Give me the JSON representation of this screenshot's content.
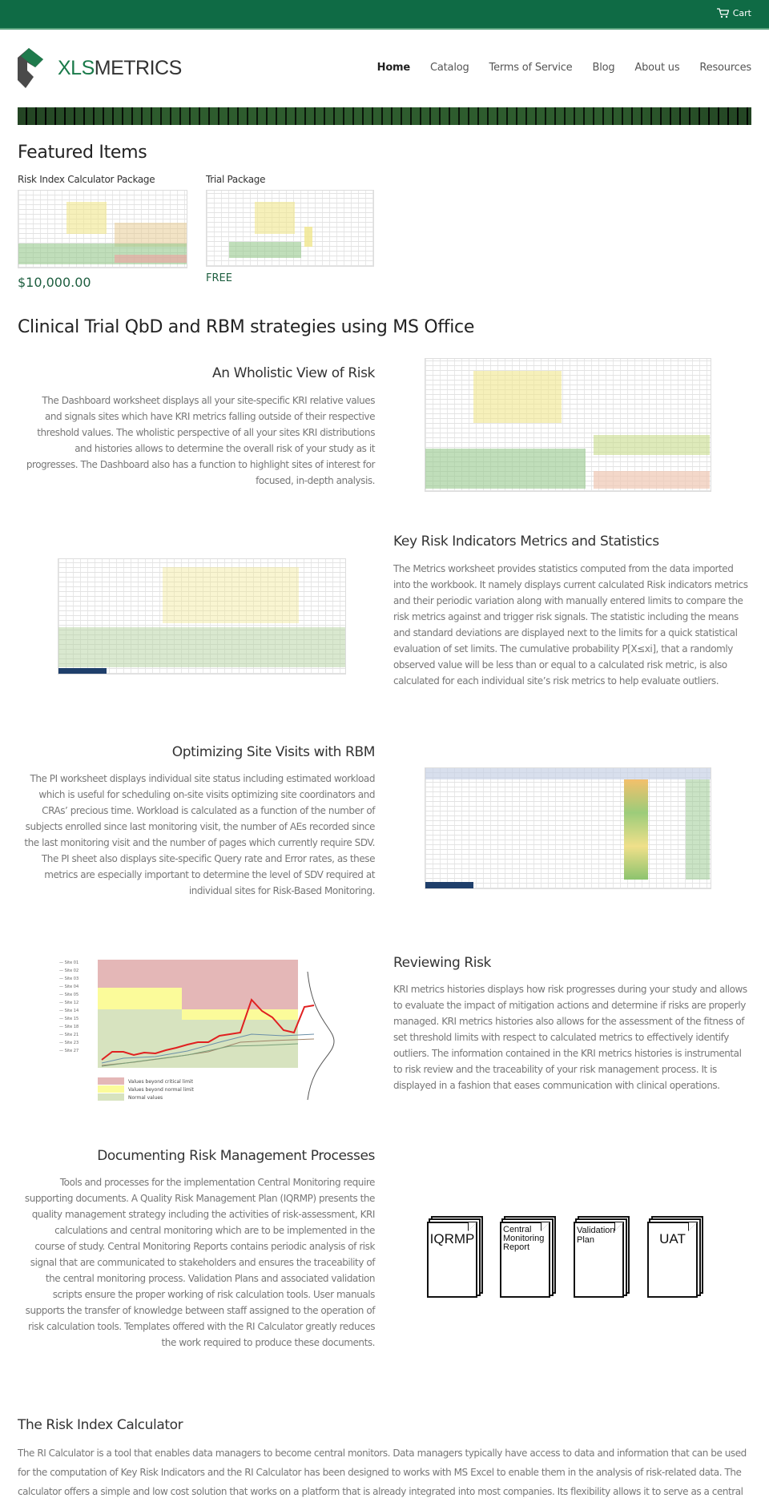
{
  "topbar": {
    "cart_label": "Cart",
    "cart_icon": "shopping-cart-icon",
    "color": "#0f6b45"
  },
  "logo": {
    "text_xls": "XLS",
    "text_metrics": "METRICS"
  },
  "nav": {
    "items": [
      {
        "label": "Home",
        "active": true
      },
      {
        "label": "Catalog"
      },
      {
        "label": "Terms of Service"
      },
      {
        "label": "Blog"
      },
      {
        "label": "About us"
      },
      {
        "label": "Resources"
      }
    ]
  },
  "featured": {
    "title": "Featured Items",
    "products": [
      {
        "name": "Risk Index Calculator Package",
        "price": "$10,000.00"
      },
      {
        "name": "Trial Package",
        "price": "FREE"
      }
    ],
    "price_color": "#1d5e3f"
  },
  "main_title": "Clinical Trial QbD and RBM strategies using MS Office",
  "sections": [
    {
      "title": "An Wholistic View of Risk",
      "text": "The Dashboard worksheet displays all your site-specific KRI relative values and signals sites which have KRI metrics falling outside of their respective threshold values. The wholistic perspective of all your sites KRI distributions and histories allows to determine the overall risk of your study as it progresses. The Dashboard also has a function to highlight sites of interest for focused, in-depth analysis."
    },
    {
      "title": "Key Risk Indicators Metrics and Statistics",
      "text": "The Metrics worksheet provides statistics computed from the data imported into the workbook. It namely displays current calculated Risk indicators metrics and their periodic variation along with manually entered limits to compare the risk metrics against and trigger risk signals. The statistic including the means and standard deviations are displayed next to the limits for a quick statistical evaluation of set limits. The cumulative probability P[X≤xi], that a randomly observed value will be less than or equal to a calculated risk metric, is also calculated for each individual site’s risk metrics to help evaluate outliers."
    },
    {
      "title": "Optimizing Site Visits with RBM",
      "text": "The PI worksheet displays individual site status including estimated workload which is useful for scheduling on-site visits optimizing site coordinators and CRAs’ precious time. Workload is calculated as a function of the number of subjects enrolled since last monitoring visit, the number of AEs recorded since the last monitoring visit and the number of pages which currently require SDV. The PI sheet also displays site-specific Query rate and Error rates, as these metrics are especially important to determine the level of SDV required at individual sites for Risk-Based Monitoring."
    },
    {
      "title": "Reviewing Risk",
      "text": "KRI metrics histories displays how risk progresses during your study and allows to evaluate the impact of mitigation actions and determine if risks are properly managed. KRI metrics histories also allows for the assessment of the fitness of set threshold limits with respect to calculated metrics to effectively identify outliers. The information contained in the KRI metrics histories is instrumental to risk review and the traceability of your risk management process. It is displayed in a fashion that eases communication with clinical operations.",
      "chart_legend": [
        "Values beyond critical limit",
        "Values beyond normal limit",
        "Normal values"
      ]
    },
    {
      "title": "Documenting Risk Management Processes",
      "text": "Tools and processes for the implementation Central Monitoring require supporting documents. A Quality Risk Management Plan (IQRMP) presents the quality management strategy including the activities of risk-assessment, KRI calculations and central monitoring which are to be implemented in the course of study. Central Monitoring Reports contains periodic analysis of risk signal that are communicated to stakeholders and ensures the traceability of the central monitoring process. Validation Plans and associated validation scripts ensure the proper working of risk calculation tools. User manuals supports the transfer of knowledge between staff assigned to the operation of risk calculation tools. Templates offered with the RI Calculator greatly reduces the work required to produce these documents.",
      "documents": [
        "IQRMP",
        "Central Monitoring Report",
        "Validation Plan",
        "UAT"
      ]
    }
  ],
  "calculator": {
    "title": "The Risk Index Calculator",
    "text": "The RI Calculator is a tool that enables data managers to become central monitors. Data managers typically have access to data and information that can be used for the computation of Key Risk Indicators and the RI Calculator has been designed to works with MS Excel to enable them in the analysis of risk-related data. The calculator offers a simple and low cost solution that works on a platform that is already integrated into most companies. Its flexibility allows it to serve as a central monitoring tool that can deploy QbD and RBM strategies integrated with the different processes and systems of different clinical"
  }
}
